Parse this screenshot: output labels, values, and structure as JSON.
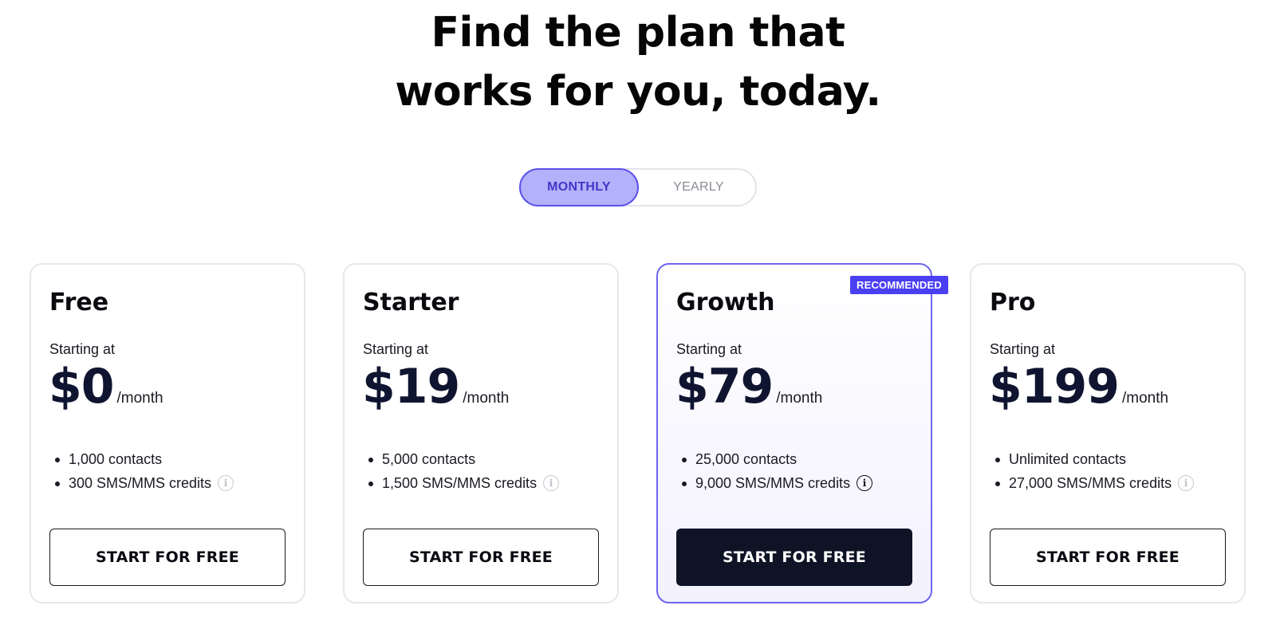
{
  "headline": {
    "line1": "Find the plan that",
    "line2": "works for you, today."
  },
  "billing_toggle": {
    "monthly": "MONTHLY",
    "yearly": "YEARLY",
    "selected": "MONTHLY"
  },
  "plans": [
    {
      "name": "Free",
      "starting_label": "Starting at",
      "price": "$0",
      "period": "/month",
      "features": [
        "1,000 contacts",
        "300 SMS/MMS credits"
      ],
      "cta": "START FOR FREE",
      "recommended": false
    },
    {
      "name": "Starter",
      "starting_label": "Starting at",
      "price": "$19",
      "period": "/month",
      "features": [
        "5,000 contacts",
        "1,500 SMS/MMS credits"
      ],
      "cta": "START FOR FREE",
      "recommended": false
    },
    {
      "name": "Growth",
      "starting_label": "Starting at",
      "price": "$79",
      "period": "/month",
      "features": [
        "25,000 contacts",
        "9,000 SMS/MMS credits"
      ],
      "cta": "START FOR FREE",
      "recommended": true,
      "badge": "RECOMMENDED"
    },
    {
      "name": "Pro",
      "starting_label": "Starting at",
      "price": "$199",
      "period": "/month",
      "features": [
        "Unlimited contacts",
        "27,000 SMS/MMS credits"
      ],
      "cta": "START FOR FREE",
      "recommended": false
    }
  ],
  "icons": {
    "info": "info-icon",
    "info_glyph": "i"
  },
  "colors": {
    "accent": "#4a3ff2",
    "toggle_active_bg": "#b4b1fb",
    "cta_dark": "#0f1326"
  }
}
